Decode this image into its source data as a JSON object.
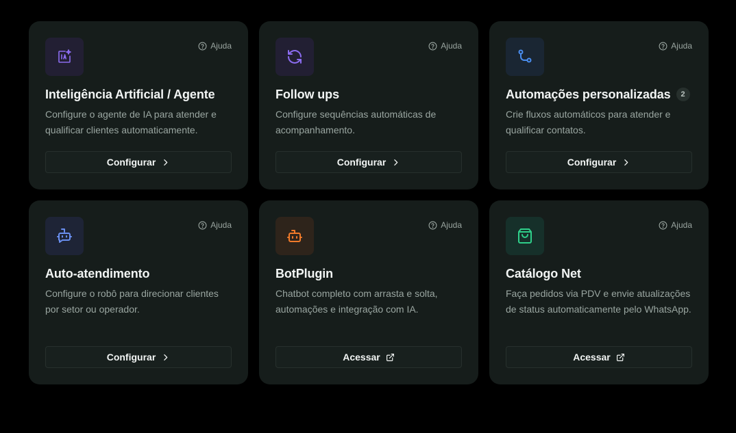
{
  "cards": [
    {
      "title": "Inteligência Artificial / Agente",
      "description": "Configure o agente de IA para atender e qualificar clientes automaticamente.",
      "help_label": "Ajuda",
      "action_label": "Configurar",
      "icon": "ai-sparkle-icon",
      "icon_color": "#8b6cf0",
      "icon_bg": "#221f33"
    },
    {
      "title": "Follow ups",
      "description": "Configure sequências automáticas de acompanhamento.",
      "help_label": "Ajuda",
      "action_label": "Configurar",
      "icon": "refresh-icon",
      "icon_color": "#8b6cf0",
      "icon_bg": "#221f33"
    },
    {
      "title": "Automações personalizadas",
      "badge": "2",
      "description": "Crie fluxos automáticos para atender e qualificar contatos.",
      "help_label": "Ajuda",
      "action_label": "Configurar",
      "icon": "git-branch-icon",
      "icon_color": "#4a8ef0",
      "icon_bg": "#1a2633"
    },
    {
      "title": "Auto-atendimento",
      "description": "Configure o robô para direcionar clientes por setor ou operador.",
      "help_label": "Ajuda",
      "action_label": "Configurar",
      "icon": "bot-message-icon",
      "icon_color": "#6a8ff0",
      "icon_bg": "#1e2436"
    },
    {
      "title": "BotPlugin",
      "description": "Chatbot completo com arrasta e solta, automações e integração com IA.",
      "help_label": "Ajuda",
      "action_label": "Acessar",
      "icon": "bot-icon",
      "icon_color": "#f07a2a",
      "icon_bg": "#2e241b"
    },
    {
      "title": "Catálogo Net",
      "description": "Faça pedidos via PDV e envie atualizações de status automaticamente pelo WhatsApp.",
      "help_label": "Ajuda",
      "action_label": "Acessar",
      "icon": "shopping-bag-icon",
      "icon_color": "#2fcf8a",
      "icon_bg": "#16302a"
    }
  ]
}
